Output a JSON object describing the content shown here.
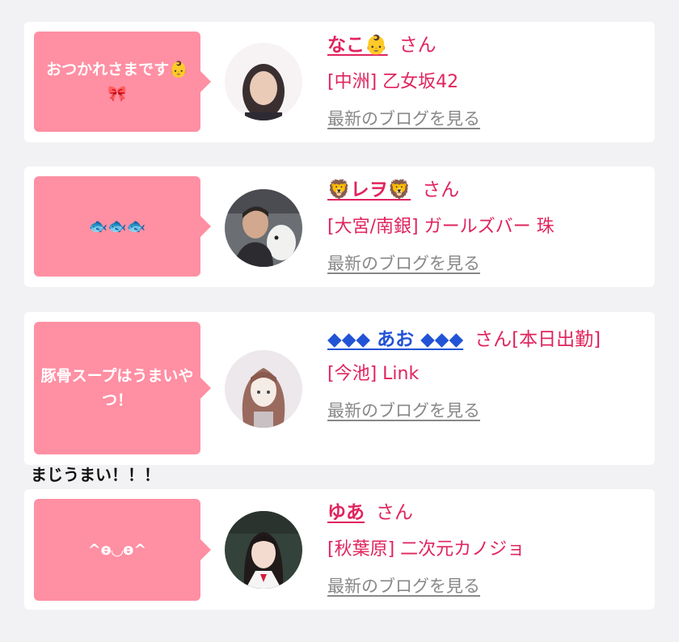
{
  "entries": [
    {
      "message": "おつかれさまです👶🎀",
      "name": "なこ👶",
      "suffix": "さん",
      "shop": "[中洲] 乙女坂42",
      "blog_link": "最新のブログを見る",
      "avatar_icon": "person-photo-icon"
    },
    {
      "message": "🐟🐟🐟",
      "name": "🦁レヲ🦁",
      "suffix": "さん",
      "shop": "[大宮/南銀] ガールズバー 珠",
      "blog_link": "最新のブログを見る",
      "avatar_icon": "person-photo-icon"
    },
    {
      "message": "豚骨スープはうまいやつ！",
      "name": "◆◆◆ あお ◆◆◆",
      "suffix": "さん[本日出勤]",
      "shop": "[今池] Link",
      "blog_link": "最新のブログを見る",
      "avatar_icon": "illustration-avatar-icon"
    },
    {
      "message": "^ө◡ө^",
      "name": "ゆあ",
      "suffix": "さん",
      "shop": "[秋葉原] 二次元カノジョ",
      "blog_link": "最新のブログを見る",
      "avatar_icon": "person-photo-icon"
    }
  ],
  "note": "まじうまい！！！",
  "colors": {
    "bubble": "#ff8fa3",
    "accent": "#e0245e",
    "link_gray": "#888888",
    "page_bg": "#f2f2f4"
  }
}
